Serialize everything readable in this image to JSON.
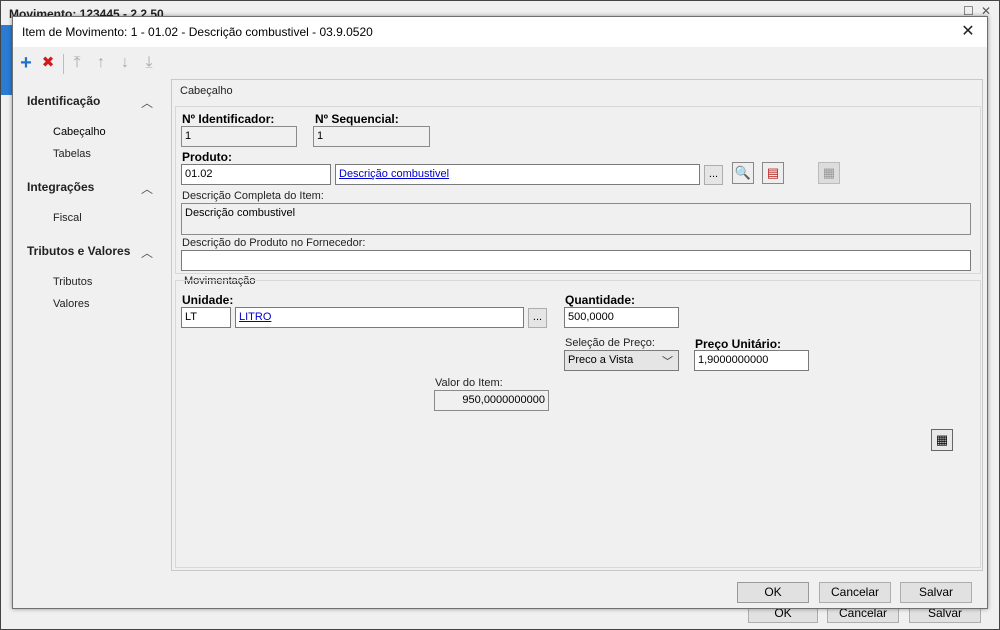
{
  "background_window": {
    "title": "Movimento: 123445 - 2.2.50",
    "buttons": {
      "ok": "OK",
      "cancel": "Cancelar",
      "save": "Salvar"
    }
  },
  "dialog": {
    "title": "Item de Movimento: 1 - 01.02 - Descrição combustivel - 03.9.0520",
    "close_glyph": "✕"
  },
  "toolbar": {
    "add_glyph": "+",
    "delete_glyph": "✖",
    "first_glyph": "⤒",
    "up_glyph": "↑",
    "down_glyph": "↓",
    "last_glyph": "⤓"
  },
  "nav": {
    "groups": [
      {
        "label": "Identificação",
        "chevron": "^",
        "items": [
          "Cabeçalho",
          "Tabelas"
        ]
      },
      {
        "label": "Integrações",
        "chevron": "^",
        "items": [
          "Fiscal"
        ]
      },
      {
        "label": "Tributos e Valores",
        "chevron": "^",
        "items": [
          "Tributos",
          "Valores"
        ]
      }
    ]
  },
  "cabecalho": {
    "section_title": "Cabeçalho",
    "id_label": "Nº Identificador:",
    "id_value": "1",
    "seq_label": "Nº Sequencial:",
    "seq_value": "1",
    "produto_label": "Produto:",
    "produto_code": "01.02",
    "produto_desc": "Descrição combustivel",
    "dots": "...",
    "desc_completa_label": "Descrição Completa do Item:",
    "desc_completa_value": "Descrição combustivel",
    "desc_fornecedor_label": "Descrição do Produto no Fornecedor:",
    "desc_fornecedor_value": ""
  },
  "movimentacao": {
    "section_title": "Movimentação",
    "unidade_label": "Unidade:",
    "unidade_code": "LT",
    "unidade_desc": "LITRO",
    "dots": "...",
    "quantidade_label": "Quantidade:",
    "quantidade_value": "500,0000",
    "selecao_label": "Seleção de Preço:",
    "selecao_value": "Preco a Vista",
    "preco_label": "Preço Unitário:",
    "preco_value": "1,9000000000",
    "valor_label": "Valor do Item:",
    "valor_value": "950,0000000000"
  },
  "footer": {
    "ok": "OK",
    "cancel": "Cancelar",
    "save": "Salvar"
  },
  "icons": {
    "add": "plus-icon",
    "delete": "delete-icon",
    "first": "move-first-icon",
    "up": "move-up-icon",
    "down": "move-down-icon",
    "last": "move-last-icon",
    "search": "search-icon",
    "edit": "edit-record-icon",
    "disabled": "disabled-action-icon",
    "calculator": "calculator-icon"
  },
  "colors": {
    "add": "#1e73c9",
    "delete": "#d11a1a",
    "link": "#0000cc"
  }
}
